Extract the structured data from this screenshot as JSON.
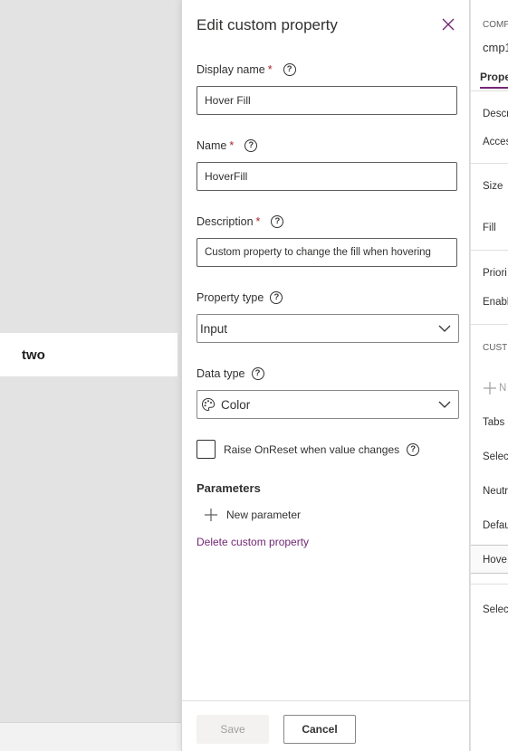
{
  "canvas": {
    "item_label": "two"
  },
  "panel": {
    "title": "Edit custom property",
    "display_name": {
      "label": "Display name",
      "required_marker": "*",
      "value": "Hover Fill"
    },
    "name": {
      "label": "Name",
      "required_marker": "*",
      "value": "HoverFill"
    },
    "description": {
      "label": "Description",
      "required_marker": "*",
      "value": "Custom property to change the fill when hovering"
    },
    "property_type": {
      "label": "Property type",
      "selected": "Input"
    },
    "data_type": {
      "label": "Data type",
      "selected": "Color"
    },
    "raise_onreset": {
      "label": "Raise OnReset when value changes",
      "checked": false
    },
    "parameters": {
      "heading": "Parameters",
      "new_parameter_label": "New parameter"
    },
    "delete_link": "Delete custom property",
    "footer": {
      "save_label": "Save",
      "cancel_label": "Cancel",
      "save_enabled": false
    }
  },
  "properties_pane": {
    "header_small": "COMP",
    "component_name": "cmp1",
    "tab_label": "Prope",
    "items": {
      "desc": "Descr",
      "access": "Acces",
      "size": "Size",
      "fill": "Fill",
      "priority": "Priori",
      "enable": "Enabl",
      "custom_header": "CUST",
      "new": "N",
      "tabs": "Tabs",
      "selected": "Selec",
      "neutral": "Neutr",
      "default": "Defau",
      "hover": "Hove",
      "selected2": "Selec"
    }
  },
  "colors": {
    "accent": "#742774",
    "required": "#a4262c",
    "text": "#323130"
  }
}
